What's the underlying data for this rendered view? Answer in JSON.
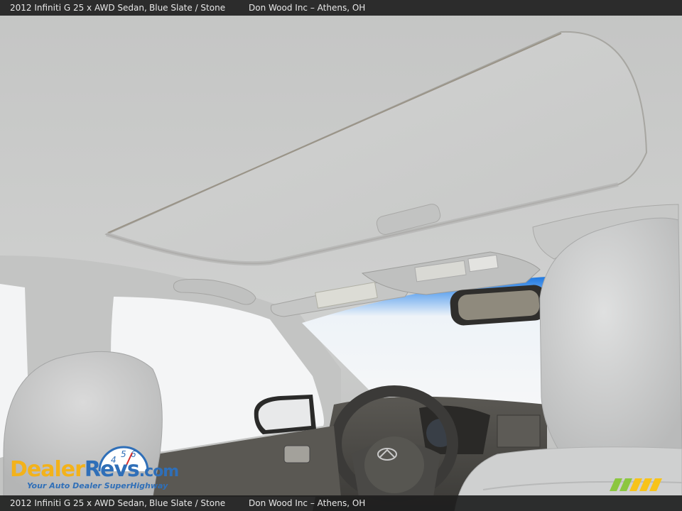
{
  "caption": {
    "vehicle": "2012 Infiniti G 25 x AWD Sedan,",
    "colors": "Blue Slate / Stone",
    "dealer": "Don Wood Inc – Athens, OH"
  },
  "watermark": {
    "brand_part1": "Dealer",
    "brand_part2": "Revs",
    "brand_suffix": ".com",
    "tagline": "Your Auto Dealer SuperHighway",
    "gauge_digits": [
      "4",
      "5",
      "6"
    ]
  },
  "colors": {
    "headliner": "#c9cac9",
    "sky": "#2f86e6",
    "window": "#f4f5f6",
    "seat": "#d2d3d3",
    "dash": "#4a4946"
  },
  "icons": [
    "infiniti-logo-icon",
    "speedometer-gauge-icon",
    "mm-stripes-logo-icon"
  ]
}
